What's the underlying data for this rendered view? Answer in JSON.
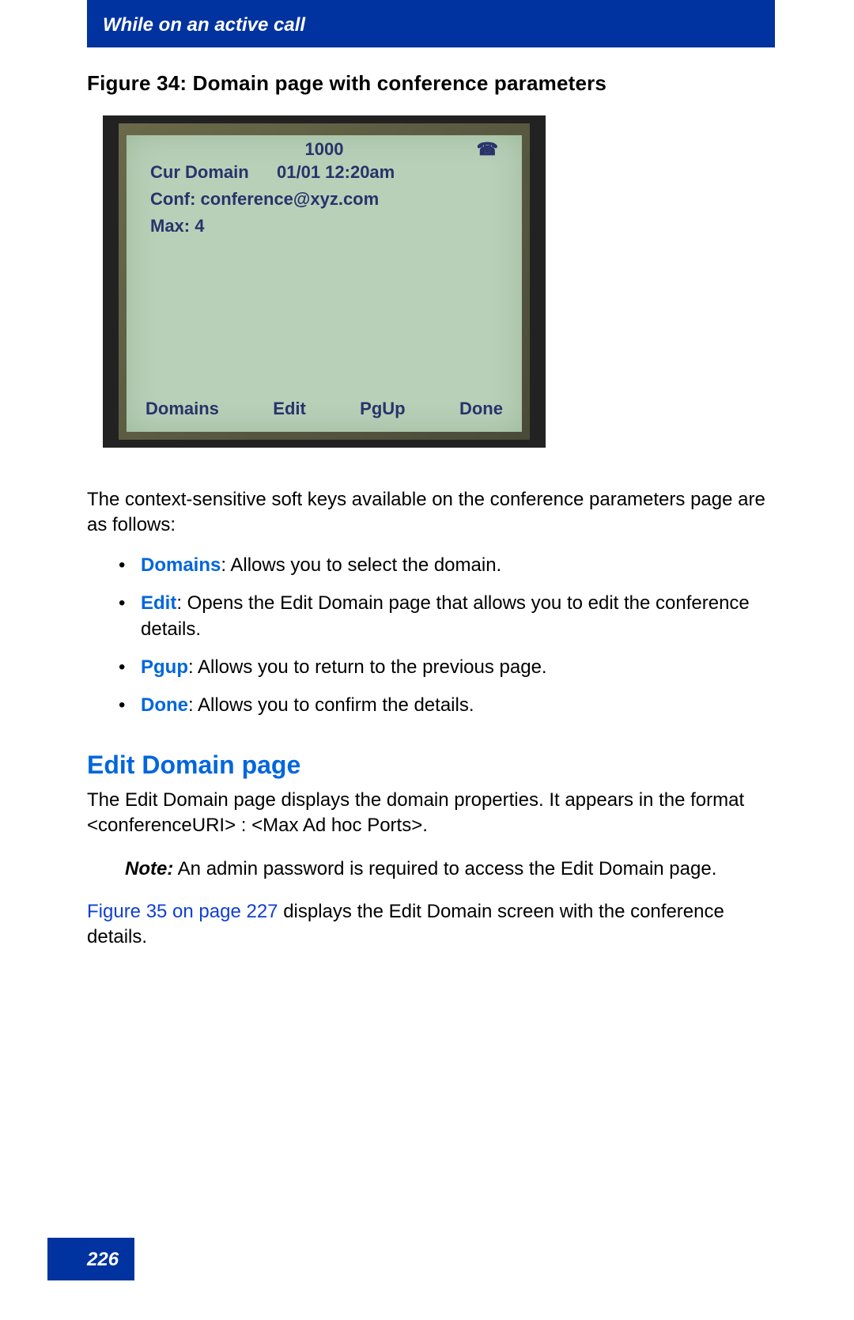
{
  "header": {
    "title": "While on an active call"
  },
  "figure": {
    "caption": "Figure 34: Domain page with conference parameters",
    "lcd": {
      "extension": "1000",
      "phone_icon": "☎",
      "row1_label": "Cur Domain",
      "row1_right": "01/01 12:20am",
      "row2": "Conf: conference@xyz.com",
      "row3": "Max: 4",
      "softkeys": [
        "Domains",
        "Edit",
        "PgUp",
        "Done"
      ]
    }
  },
  "intro": "The context-sensitive soft keys available on the conference parameters page are as follows:",
  "bullets": [
    {
      "term": "Domains",
      "desc": ": Allows you to select the domain."
    },
    {
      "term": "Edit",
      "desc": ": Opens the Edit Domain page that allows you to edit the conference details."
    },
    {
      "term": "Pgup",
      "desc": ": Allows you to return to the previous page."
    },
    {
      "term": "Done",
      "desc": ": Allows you to confirm the details."
    }
  ],
  "section": {
    "heading": "Edit Domain page",
    "p1": "The Edit Domain page displays the domain properties. It appears in the format <conferenceURI> : <Max Ad hoc Ports>.",
    "note_label": "Note:",
    "note_body": "  An admin password is required to access the Edit Domain page.",
    "p2_link": "Figure 35 on page 227",
    "p2_rest": " displays the Edit Domain screen with the conference details."
  },
  "footer": {
    "page_number": "226"
  }
}
